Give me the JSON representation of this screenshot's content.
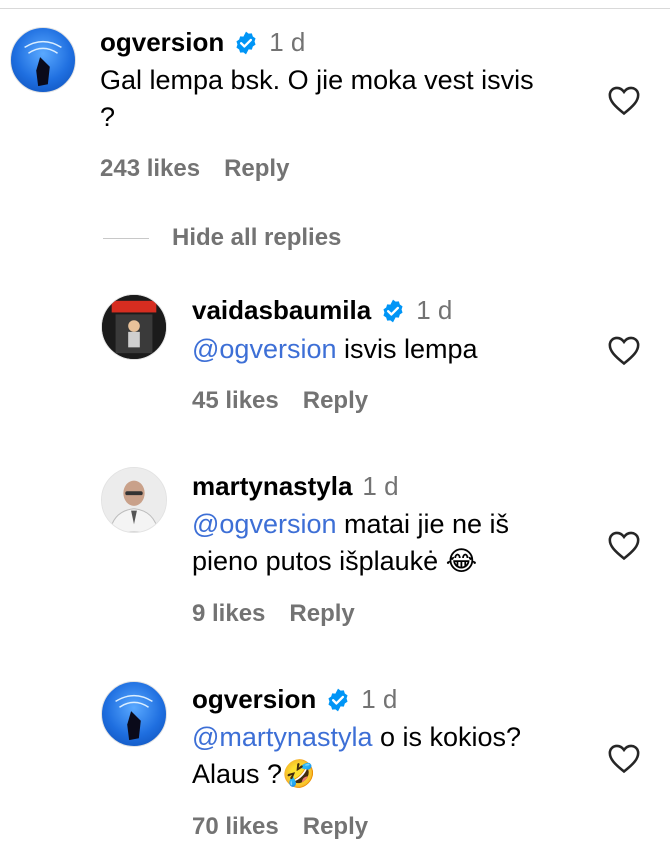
{
  "comments": [
    {
      "username": "ogversion",
      "verified": true,
      "time": "1 d",
      "text_line1": "Gal lempa bsk. O jie moka vest isvis",
      "text_line2": "?",
      "likes": "243 likes",
      "reply": "Reply"
    }
  ],
  "hide_replies_label": "Hide all replies",
  "replies": [
    {
      "username": "vaidasbaumila",
      "verified": true,
      "time": "1 d",
      "mention": "@ogversion",
      "text_line1": " isvis lempa",
      "likes": "45 likes",
      "reply": "Reply"
    },
    {
      "username": "martynastyla",
      "verified": false,
      "time": "1 d",
      "mention": "@ogversion",
      "text_line1": " matai jie ne iš",
      "text_line2": "pieno putos išplaukė 😂",
      "likes": "9 likes",
      "reply": "Reply"
    },
    {
      "username": "ogversion",
      "verified": true,
      "time": "1 d",
      "mention": "@martynastyla",
      "text_line1": " o is kokios?",
      "text_line2": "Alaus ?🤣",
      "likes": "70 likes",
      "reply": "Reply"
    }
  ],
  "colors": {
    "verified_badge": "#0095f6",
    "mention": "#3d6fd6",
    "secondary_text": "#737373"
  }
}
